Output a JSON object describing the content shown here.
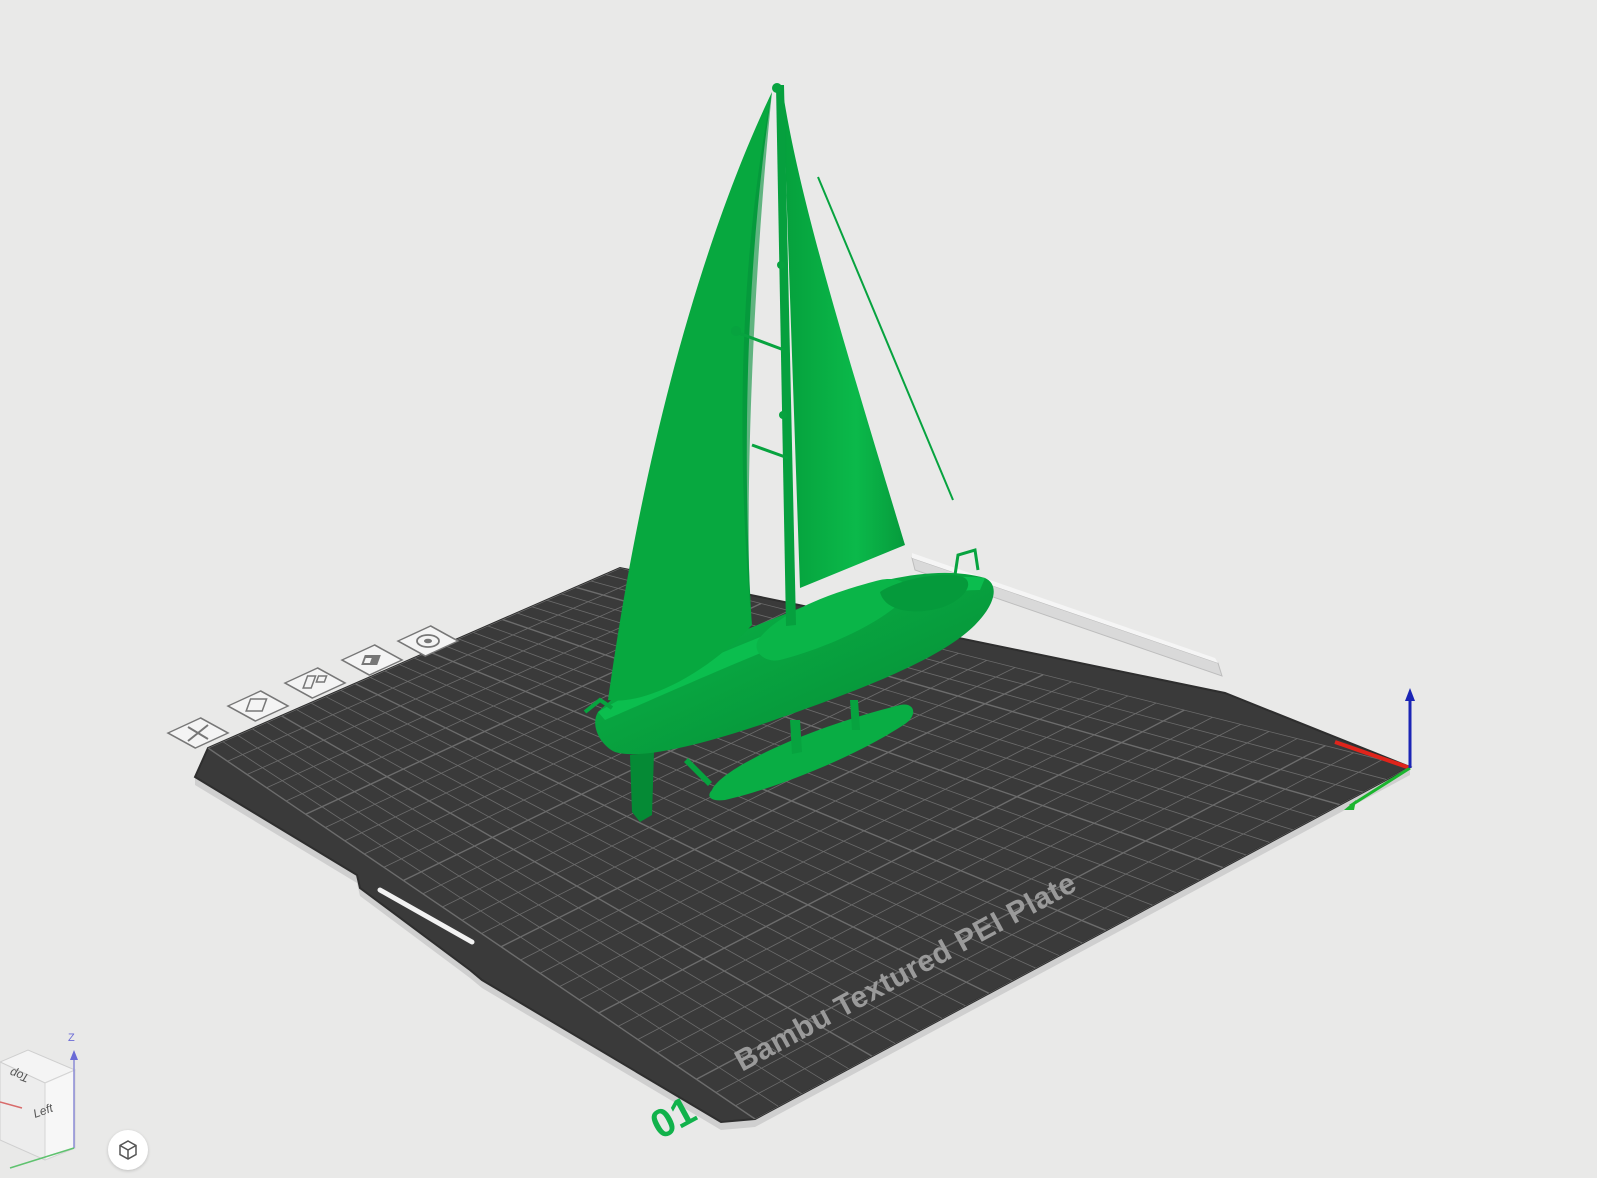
{
  "window": {
    "background": "#e9e9e8"
  },
  "plate": {
    "label": "Bambu Textured PEI Plate",
    "number": "01",
    "plate_color": "#3a3a3a",
    "grid_color": "#6c6c6c",
    "toolbar_icons": [
      "close-icon",
      "add-plate-icon",
      "arrange-icon",
      "orient-icon",
      "settings-icon"
    ]
  },
  "model": {
    "name": "sailboat",
    "color": "#07a33f",
    "shade_color": "#058a35"
  },
  "axes": {
    "x_color": "#e0241b",
    "y_color": "#1bb52f",
    "z_color": "#1b25b5"
  },
  "view_cube": {
    "top_label": "Top",
    "left_label": "Left",
    "z_label": "Z"
  },
  "view_button": {
    "icon": "view-cube-icon"
  }
}
